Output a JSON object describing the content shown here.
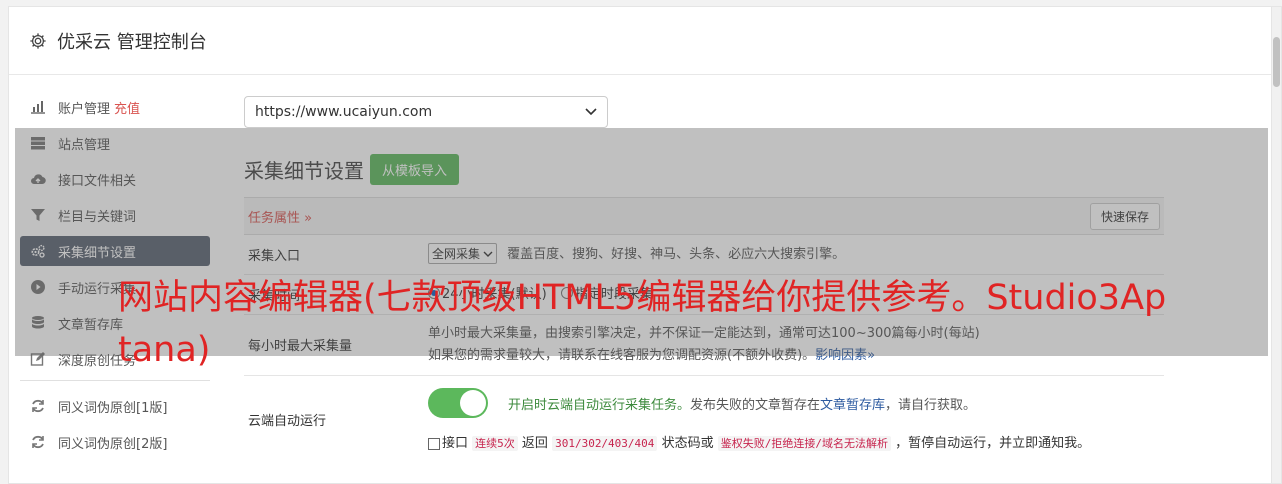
{
  "header": {
    "title": "优采云 管理控制台",
    "icon": "gear-icon"
  },
  "sidebar": {
    "items": [
      {
        "label": "账户管理",
        "badge": "充值",
        "icon": "bar-chart-icon"
      },
      {
        "label": "站点管理",
        "icon": "server-icon"
      },
      {
        "label": "接口文件相关",
        "icon": "cloud-upload-icon"
      },
      {
        "label": "栏目与关键词",
        "icon": "filter-icon"
      },
      {
        "label": "采集细节设置",
        "icon": "gears-icon",
        "active": true
      },
      {
        "label": "手动运行采集",
        "icon": "play-circle-icon"
      },
      {
        "label": "文章暂存库",
        "icon": "database-icon"
      },
      {
        "label": "深度原创任务",
        "icon": "edit-icon"
      }
    ],
    "items2": [
      {
        "label": "同义词伪原创[1版]",
        "icon": "refresh-icon"
      },
      {
        "label": "同义词伪原创[2版]",
        "icon": "refresh-icon"
      }
    ]
  },
  "content": {
    "site_url": "https://www.ucaiyun.com",
    "section_title": "采集细节设置",
    "import_button": "从模板导入",
    "task_attr_label": "任务属性 »",
    "quick_save": "快速保存",
    "rows": {
      "entry": {
        "key": "采集入口",
        "select": "全网采集",
        "desc": "覆盖百度、搜狗、好搜、神马、头条、必应六大搜索引擎。"
      },
      "time": {
        "key": "采集时间",
        "opt1": "24小时采集(默认)",
        "opt2": "指定时段采集"
      },
      "max": {
        "key": "每小时最大采集量",
        "line1_mid": "单小时最大采集量，由搜索引擎决定，并不保证一定能达到",
        "line1_end": "，通常可达100~300篇每小时(每站)",
        "line2": "如果您的需求量较大，请联系在线客服为您调配资源(不额外收费)。",
        "link": "影响因素»"
      },
      "cloud": {
        "key": "云端自动运行",
        "on_text": "开启时云端自动运行采集任务。",
        "desc_pre": "发布失败的文章暂存在",
        "desc_link": "文章暂存库",
        "desc_post": "，请自行获取。",
        "cb_pre": "接口",
        "cb_code1": "连续5次",
        "cb_mid1": "返回",
        "cb_code2": "301/302/403/404",
        "cb_mid2": "状态码或",
        "cb_code3": "鉴权失败/拒绝连接/域名无法解析",
        "cb_post": "，暂停自动运行，并立即通知我。"
      }
    }
  },
  "overlay_title": "网站内容编辑器(七款顶级HTML5编辑器给你提供参考。Studio3Aptana)",
  "colors": {
    "active_nav": "#5a6372",
    "green": "#5cb85c",
    "red": "#d9534f",
    "link": "#2c5aa0"
  }
}
